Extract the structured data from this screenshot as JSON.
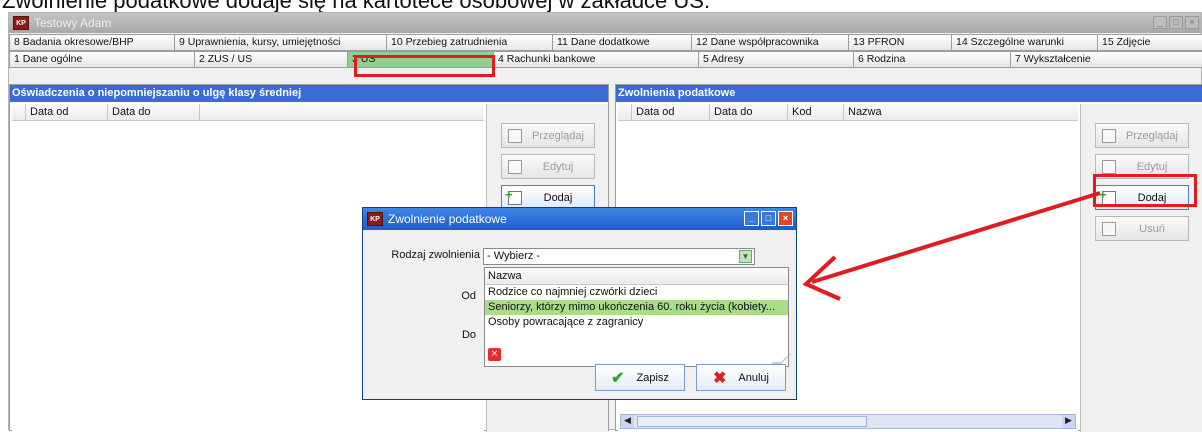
{
  "caption": "Zwolnienie podatkowe dodaje się na kartotece osobowej w zakładce US.",
  "window": {
    "title": "Testowy Adam",
    "app_icon": "KP"
  },
  "tabs_row1": [
    "8 Badania okresowe/BHP",
    "9 Uprawnienia, kursy, umiejętności",
    "10 Przebieg zatrudnienia",
    "11 Dane dodatkowe",
    "12 Dane współpracownika",
    "13 PFRON",
    "14 Szczególne warunki",
    "15 Zdjęcie"
  ],
  "tabs_row2": [
    "1 Dane ogólne",
    "2 ZUS / US",
    "3 US",
    "4 Rachunki bankowe",
    "5 Adresy",
    "6 Rodzina",
    "7 Wykształcenie"
  ],
  "left_panel": {
    "title": "Oświadczenia o niepomniejszaniu o ulgę klasy średniej",
    "columns": [
      "",
      "Data od",
      "Data do",
      ""
    ],
    "buttons": {
      "view": "Przeglądaj",
      "edit": "Edytuj",
      "add": "Dodaj"
    }
  },
  "right_panel": {
    "title": "Zwolnienia podatkowe",
    "columns": [
      "",
      "Data od",
      "Data do",
      "Kod",
      "Nazwa"
    ],
    "buttons": {
      "view": "Przeglądaj",
      "edit": "Edytuj",
      "add": "Dodaj",
      "delete": "Usuń"
    }
  },
  "dialog": {
    "title": "Zwolnienie podatkowe",
    "icon": "KP",
    "field_label": "Rodzaj zwolnienia",
    "select_value": "- Wybierz -",
    "from_label": "Od",
    "to_label": "Do",
    "dropdown_header": "Nazwa",
    "dropdown_options": [
      "Rodzice co najmniej czwórki dzieci",
      "Seniorzy, którzy mimo ukończenia 60. roku życia (kobiety...",
      "Osoby powracające z zagranicy"
    ],
    "selected_option_index": 1,
    "save_label": "Zapisz",
    "cancel_label": "Anuluj"
  },
  "colors": {
    "active_tab": "#8fd08f",
    "panel_header": "#3b6bd4",
    "highlight": "#e11b22",
    "selected_row": "#a8dd8a"
  }
}
